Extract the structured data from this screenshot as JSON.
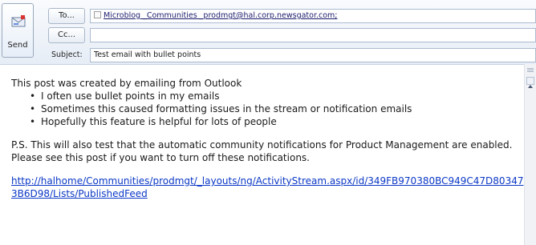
{
  "compose": {
    "send_label": "Send",
    "to_label": "To...",
    "cc_label": "Cc...",
    "subject_label": "Subject:",
    "to_value": "Microblog _Communities _prodmgt@hal.corp.newsgator.com;",
    "cc_value": "",
    "subject_value": "Test email with bullet points"
  },
  "body": {
    "intro": "This post was created by emailing from Outlook",
    "bullets": [
      "I often use bullet points in my emails",
      "Sometimes this caused formatting issues in the stream or notification emails",
      "Hopefully this feature is helpful for lots of people"
    ],
    "ps": "P.S.  This will also test that the automatic community notifications for Product Management are enabled.  Please see this post if you want to turn off these notifications.",
    "link": "http://halhome/Communities/prodmgt/_layouts/ng/ActivityStream.aspx/id/349FB970380BC949C47D803473B6D98/Lists/PublishedFeed"
  },
  "icons": {
    "send": "send-envelope-icon",
    "recipient": "contact-card-icon",
    "scroll_up": "chevron-up-icon"
  },
  "colors": {
    "link": "#0b38c6",
    "header_bg": "#e6edf6"
  }
}
